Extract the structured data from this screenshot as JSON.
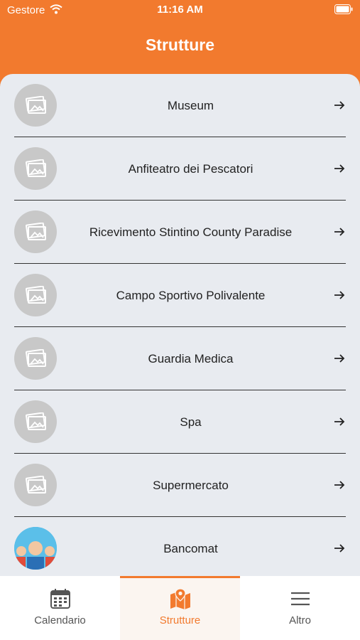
{
  "status_bar": {
    "carrier": "Gestore",
    "time": "11:16 AM"
  },
  "header": {
    "title": "Strutture"
  },
  "list": {
    "items": [
      {
        "label": "Museum",
        "thumb": "image-placeholder-icon"
      },
      {
        "label": "Anfiteatro dei Pescatori",
        "thumb": "image-placeholder-icon"
      },
      {
        "label": "Ricevimento Stintino County Paradise",
        "thumb": "image-placeholder-icon"
      },
      {
        "label": "Campo Sportivo Polivalente",
        "thumb": "image-placeholder-icon"
      },
      {
        "label": "Guardia Medica",
        "thumb": "image-placeholder-icon"
      },
      {
        "label": "Spa",
        "thumb": "image-placeholder-icon"
      },
      {
        "label": "Supermercato",
        "thumb": "image-placeholder-icon"
      },
      {
        "label": "Bancomat",
        "thumb": "avatar-photo"
      }
    ]
  },
  "tabbar": {
    "tabs": [
      {
        "label": "Calendario",
        "icon": "calendar-icon"
      },
      {
        "label": "Strutture",
        "icon": "map-pin-icon",
        "active": true
      },
      {
        "label": "Altro",
        "icon": "menu-icon"
      }
    ]
  },
  "colors": {
    "accent": "#f27a2e",
    "background": "#e8ebf0"
  }
}
